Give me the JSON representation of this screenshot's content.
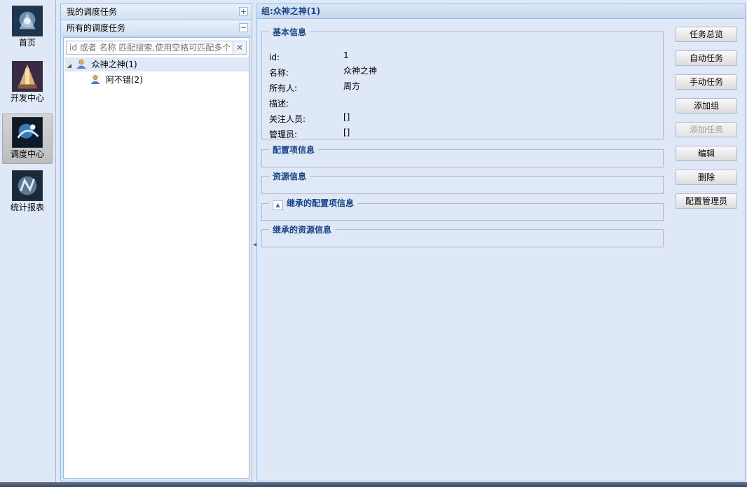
{
  "nav": {
    "items": [
      {
        "label": "首页",
        "icon": "home-icon"
      },
      {
        "label": "开发中心",
        "icon": "dev-center-icon"
      },
      {
        "label": "调度中心",
        "icon": "schedule-center-icon"
      },
      {
        "label": "统计报表",
        "icon": "report-icon"
      }
    ]
  },
  "tree_panel": {
    "my_tasks_header": "我的调度任务",
    "all_tasks_header": "所有的调度任务",
    "my_tasks_toggle": "+",
    "all_tasks_toggle": "−",
    "search_placeholder": "id 或者 名称 匹配搜索,使用空格可匹配多个",
    "search_clear": "✕",
    "nodes": [
      {
        "label": "众神之神(1)"
      },
      {
        "label": "阿不错(2)"
      }
    ]
  },
  "main": {
    "title": "组:众神之神(1)",
    "basic_info": {
      "legend": "基本信息",
      "rows": [
        {
          "label": "id:",
          "value": "1"
        },
        {
          "label": "名称:",
          "value": "众神之神"
        },
        {
          "label": "所有人:",
          "value": "周方"
        },
        {
          "label": "描述:",
          "value": ""
        },
        {
          "label": "关注人员:",
          "value": "[]"
        },
        {
          "label": "管理员:",
          "value": "[]"
        }
      ]
    },
    "config_legend": "配置项信息",
    "resource_legend": "资源信息",
    "inherited_config_legend": "继承的配置项信息",
    "inherited_resource_legend": "继承的资源信息",
    "buttons": [
      {
        "label": "任务总览",
        "enabled": true
      },
      {
        "label": "自动任务",
        "enabled": true
      },
      {
        "label": "手动任务",
        "enabled": true
      },
      {
        "label": "添加组",
        "enabled": true
      },
      {
        "label": "添加任务",
        "enabled": false
      },
      {
        "label": "编辑",
        "enabled": true
      },
      {
        "label": "删除",
        "enabled": true
      },
      {
        "label": "配置管理员",
        "enabled": true
      }
    ]
  },
  "colors": {
    "panel_bg": "#dfe8f6",
    "border": "#99bbe8",
    "title_text": "#15428b"
  }
}
